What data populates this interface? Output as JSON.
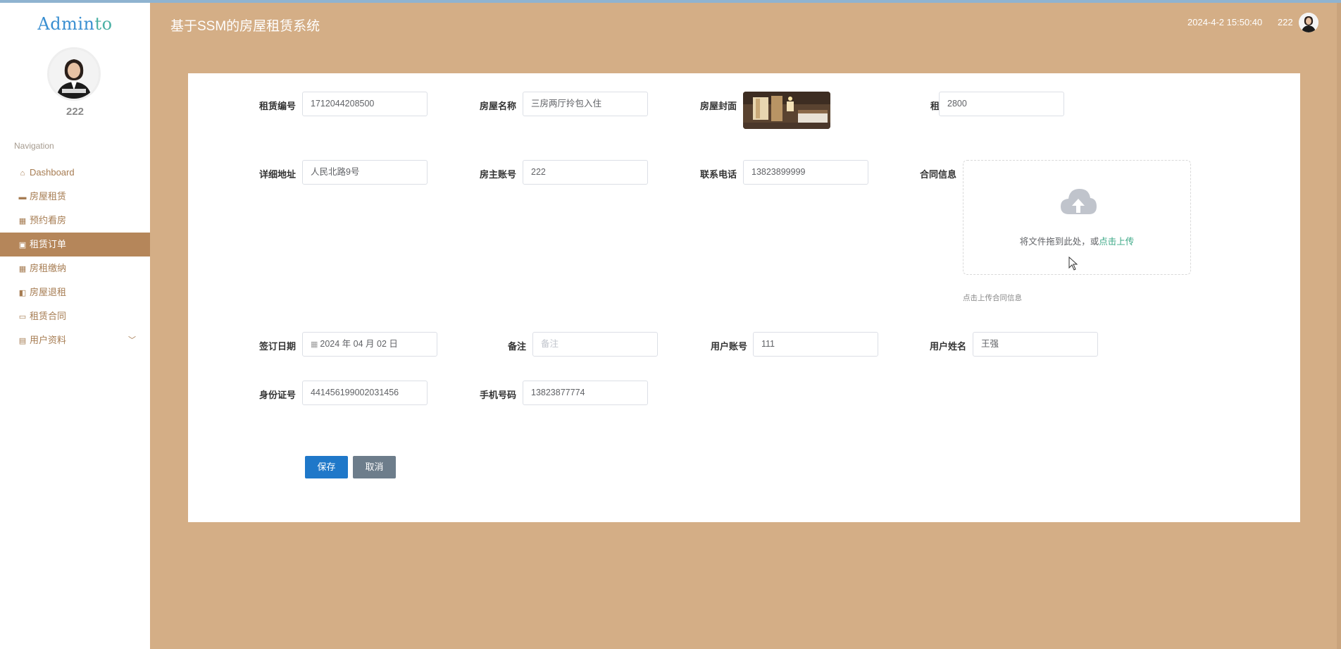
{
  "app": {
    "logo_part1": "Admin",
    "logo_part2": "to",
    "title": "基于SSM的房屋租赁系统",
    "datetime": "2024-4-2 15:50:40",
    "header_user": "222"
  },
  "sidebar": {
    "username": "222",
    "nav_title": "Navigation",
    "items": [
      {
        "label": "Dashboard",
        "icon": "home-icon"
      },
      {
        "label": "房屋租赁",
        "icon": "ticket-icon"
      },
      {
        "label": "预约看房",
        "icon": "grid-icon"
      },
      {
        "label": "租赁订单",
        "icon": "clipboard-icon",
        "active": true
      },
      {
        "label": "房租缴纳",
        "icon": "grid-icon"
      },
      {
        "label": "房屋退租",
        "icon": "wallet-icon"
      },
      {
        "label": "租赁合同",
        "icon": "comment-icon"
      },
      {
        "label": "用户资料",
        "icon": "card-icon",
        "has_submenu": true
      }
    ]
  },
  "form": {
    "rental_no": {
      "label": "租赁编号",
      "value": "1712044208500"
    },
    "house_name": {
      "label": "房屋名称",
      "value": "三房两厅拎包入住"
    },
    "cover": {
      "label": "房屋封面"
    },
    "rent": {
      "label": "租金",
      "value": "2800"
    },
    "address": {
      "label": "详细地址",
      "value": "人民北路9号"
    },
    "owner_account": {
      "label": "房主账号",
      "value": "222"
    },
    "contact_phone": {
      "label": "联系电话",
      "value": "13823899999"
    },
    "contract": {
      "label": "合同信息",
      "upload_text": "将文件拖到此处，或",
      "upload_link": "点击上传",
      "tip": "点击上传合同信息"
    },
    "sign_date": {
      "label": "签订日期",
      "value": "2024 年 04 月 02 日"
    },
    "remark": {
      "label": "备注",
      "placeholder": "备注"
    },
    "user_account": {
      "label": "用户账号",
      "value": "111"
    },
    "user_name": {
      "label": "用户姓名",
      "value": "王强"
    },
    "id_card": {
      "label": "身份证号",
      "value": "441456199002031456"
    },
    "mobile": {
      "label": "手机号码",
      "value": "13823877774"
    },
    "save_label": "保存",
    "cancel_label": "取消"
  },
  "colors": {
    "background": "#d4ae86",
    "active_nav": "#b5865a",
    "save_button": "#1f78c9",
    "cancel_button": "#6d7d8b"
  }
}
